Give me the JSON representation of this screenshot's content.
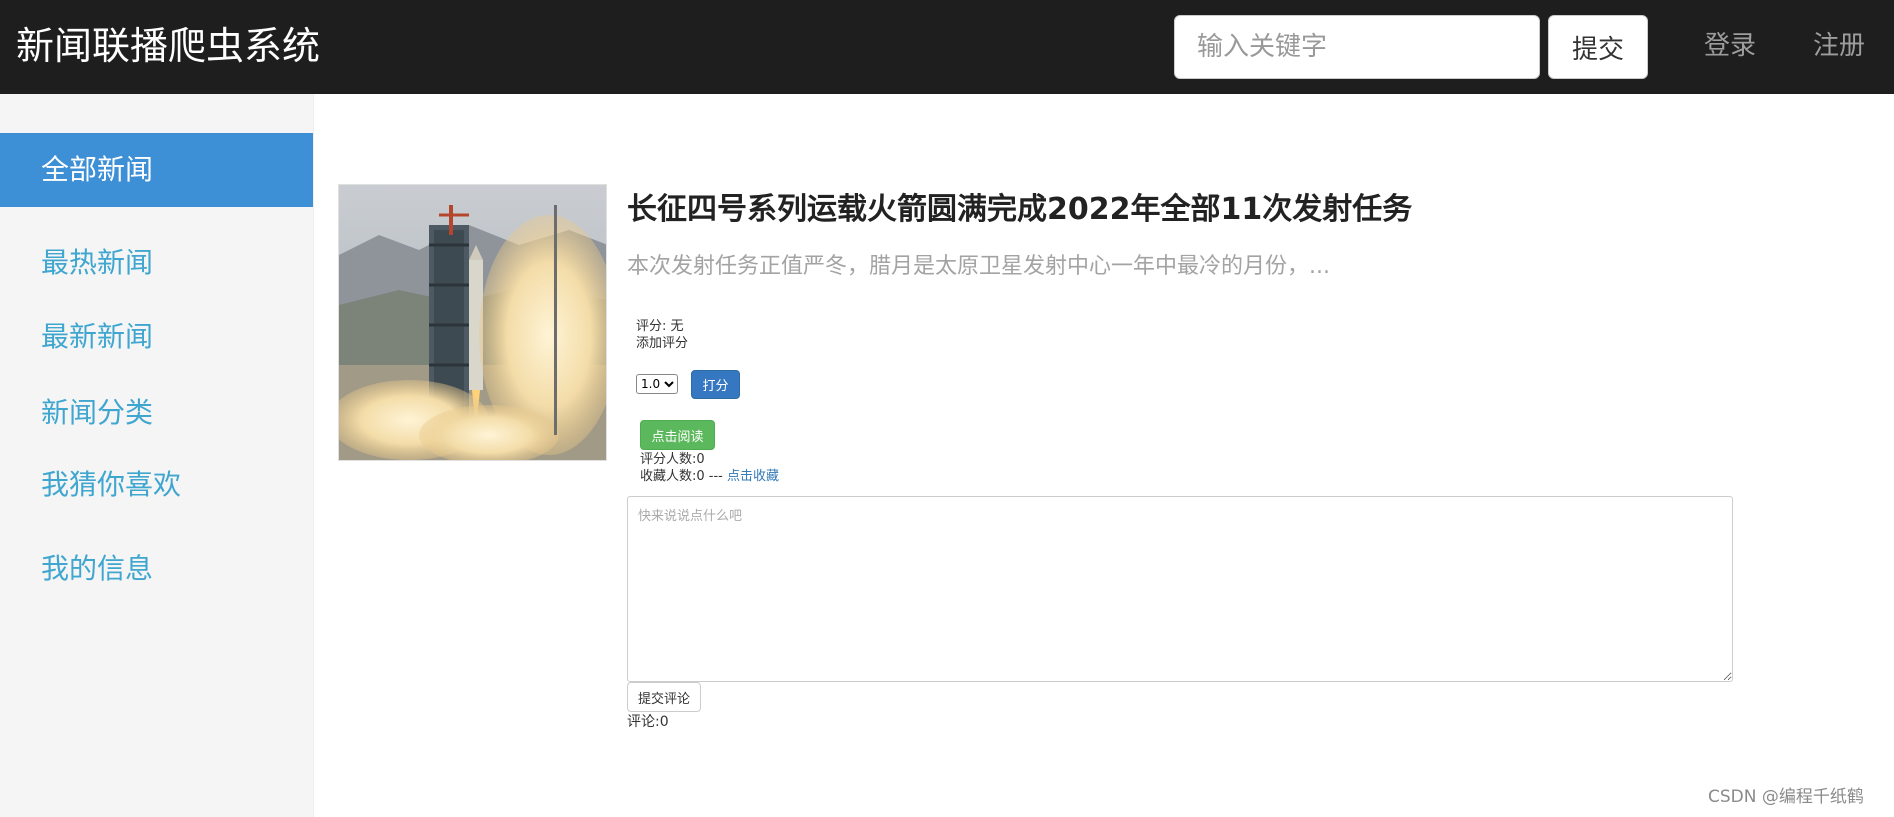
{
  "navbar": {
    "brand": "新闻联播爬虫系统",
    "search_placeholder": "输入关键字",
    "submit_label": "提交",
    "login_label": "登录",
    "register_label": "注册"
  },
  "sidebar": {
    "items": [
      {
        "label": "全部新闻",
        "active": true
      },
      {
        "label": "最热新闻"
      },
      {
        "label": "最新新闻"
      },
      {
        "label": "新闻分类"
      },
      {
        "label": "我猜你喜欢"
      },
      {
        "label": "我的信息"
      }
    ]
  },
  "news": {
    "title": "长征四号系列运载火箭圆满完成2022年全部11次发射任务",
    "summary": "本次发射任务正值严冬，腊月是太原卫星发射中心一年中最冷的月份，...",
    "score_text": "评分: 无",
    "add_score_text": "添加评分",
    "score_selected": "1.0",
    "rate_label": "打分",
    "read_label": "点击阅读",
    "raters_text": "评分人数:0",
    "fav_count_text": "收藏人数:0 --- ",
    "fav_link_text": "点击收藏",
    "comment_placeholder": "快来说说点什么吧",
    "comment_submit_label": "提交评论",
    "comment_count_text": "评论:0"
  },
  "watermark": "CSDN @编程千纸鹤",
  "colors": {
    "navbar_bg": "#1e1e1e",
    "sidebar_active": "#3d8fd6",
    "sidebar_link": "#3fa6d0",
    "primary_button": "#3577c0",
    "success_button": "#5cb85c"
  }
}
